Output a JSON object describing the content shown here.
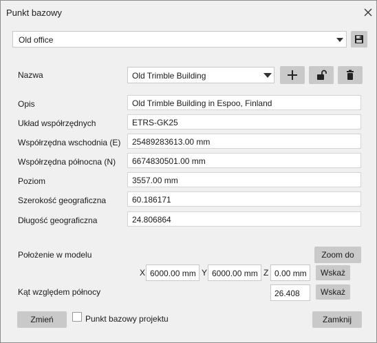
{
  "window": {
    "title": "Punkt bazowy"
  },
  "top": {
    "selected_point": "Old office"
  },
  "name_row": {
    "label": "Nazwa",
    "value": "Old Trimble Building"
  },
  "fields": [
    {
      "label": "Opis",
      "value": "Old Trimble Building in Espoo, Finland"
    },
    {
      "label": "Układ współrzędnych",
      "value": "ETRS-GK25"
    },
    {
      "label": "Współrzędna wschodnia  (E)",
      "value": "25489283613.00 mm"
    },
    {
      "label": "Współrzędna północna  (N)",
      "value": "6674830501.00 mm"
    },
    {
      "label": "Poziom",
      "value": "3557.00 mm"
    },
    {
      "label": "Szerokość geograficzna",
      "value": "60.186171"
    },
    {
      "label": "Długość geograficzna",
      "value": "24.806864"
    }
  ],
  "model_position": {
    "label": "Położenie w modelu",
    "zoom_label": "Zoom do",
    "x_label": "X",
    "x_value": "6000.00 mm",
    "y_label": "Y",
    "y_value": "6000.00 mm",
    "z_label": "Z",
    "z_value": "0.00 mm",
    "show_label": "Wskaż"
  },
  "north_angle": {
    "label": "Kąt względem północy",
    "value": "26.408",
    "show_label": "Wskaż"
  },
  "footer": {
    "change_label": "Zmień",
    "project_base_point_label": "Punkt bazowy projektu",
    "close_label": "Zamknij"
  }
}
